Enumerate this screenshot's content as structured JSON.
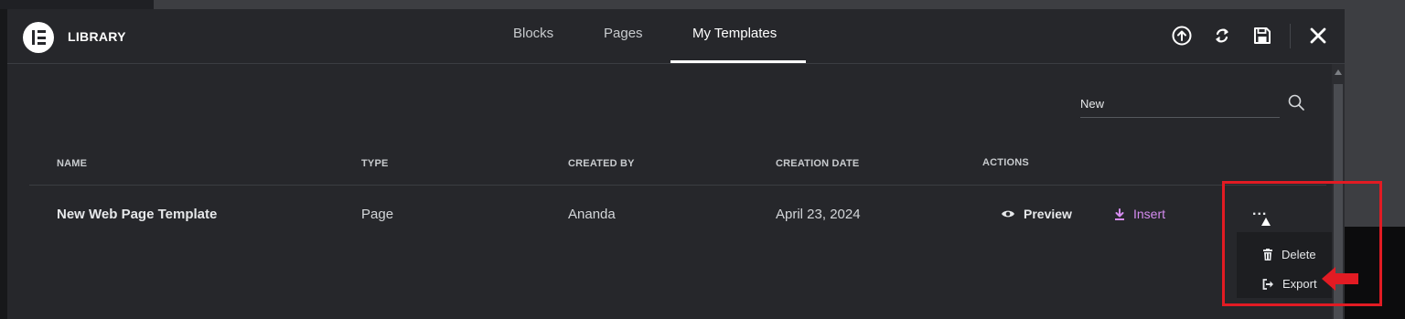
{
  "library": {
    "title": "LIBRARY",
    "tabs": [
      {
        "label": "Blocks",
        "active": false
      },
      {
        "label": "Pages",
        "active": false
      },
      {
        "label": "My Templates",
        "active": true
      }
    ]
  },
  "search": {
    "value": "New"
  },
  "table": {
    "headers": {
      "name": "NAME",
      "type": "TYPE",
      "created_by": "CREATED BY",
      "creation_date": "CREATION DATE",
      "actions": "ACTIONS"
    },
    "rows": [
      {
        "name": "New Web Page Template",
        "type": "Page",
        "created_by": "Ananda",
        "creation_date": "April 23, 2024",
        "preview_label": "Preview",
        "insert_label": "Insert",
        "more_label": "..."
      }
    ]
  },
  "dropdown": {
    "items": [
      {
        "label": "Delete",
        "icon": "trash-icon"
      },
      {
        "label": "Export",
        "icon": "export-icon"
      }
    ]
  },
  "colors": {
    "modal_bg": "#26272b",
    "insert_accent": "#d58cf0",
    "highlight": "#e21b23"
  },
  "icons": {
    "header": [
      "elementor-logo-icon",
      "upload-icon",
      "sync-icon",
      "save-icon",
      "close-icon"
    ],
    "actions": [
      "eye-icon",
      "download-icon"
    ]
  }
}
